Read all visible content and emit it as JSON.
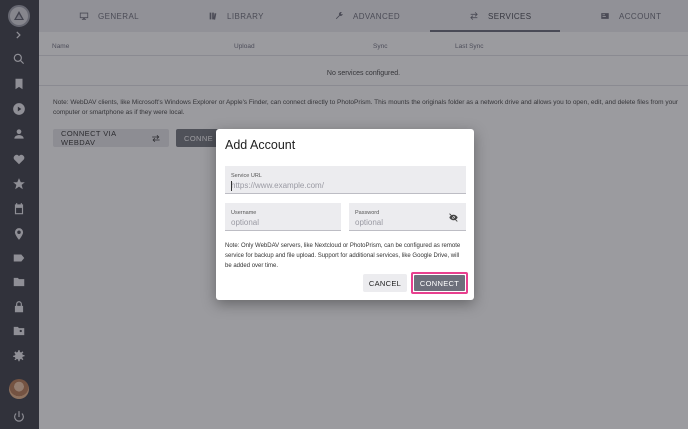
{
  "sidebar": {
    "icons": [
      "logo-icon",
      "expand-chevron-icon",
      "search-icon",
      "bookmark-icon",
      "play-icon",
      "person-icon",
      "heart-icon",
      "star-icon",
      "calendar-icon",
      "place-icon",
      "label-icon",
      "folder-icon",
      "lock-icon",
      "folder-shared-icon",
      "settings-icon",
      "avatar",
      "power-icon"
    ]
  },
  "tabs": [
    {
      "label": "GENERAL",
      "icon": "monitor-icon"
    },
    {
      "label": "LIBRARY",
      "icon": "library-icon"
    },
    {
      "label": "ADVANCED",
      "icon": "wrench-icon"
    },
    {
      "label": "SERVICES",
      "icon": "sync-icon",
      "active": true
    },
    {
      "label": "ACCOUNT",
      "icon": "account-icon"
    }
  ],
  "table": {
    "headers": [
      "Name",
      "Upload",
      "Sync",
      "Last Sync"
    ],
    "empty_message": "No services configured."
  },
  "page_note": "Note: WebDAV clients, like Microsoft's Windows Explorer or Apple's Finder, can connect directly to PhotoPrism. This mounts the originals folder as a network drive and allows you to open, edit, and delete files from your computer or smartphone as if they were local.",
  "buttons": {
    "connect_webdav": "CONNECT VIA WEBDAV",
    "connect_partial": "CONNE"
  },
  "dialog": {
    "title": "Add Account",
    "service_url": {
      "label": "Service URL",
      "placeholder": "https://www.example.com/",
      "value": ""
    },
    "username": {
      "label": "Username",
      "placeholder": "optional",
      "value": ""
    },
    "password": {
      "label": "Password",
      "placeholder": "optional",
      "value": ""
    },
    "note": "Note: Only WebDAV servers, like Nextcloud or PhotoPrism, can be configured as remote service for backup and file upload. Support for additional services, like Google Drive, will be added over time.",
    "cancel_label": "CANCEL",
    "connect_label": "CONNECT"
  },
  "colors": {
    "sidebar": "#3b3d46",
    "accent_highlight": "#e8408f",
    "primary_button": "#6d6f7b"
  }
}
